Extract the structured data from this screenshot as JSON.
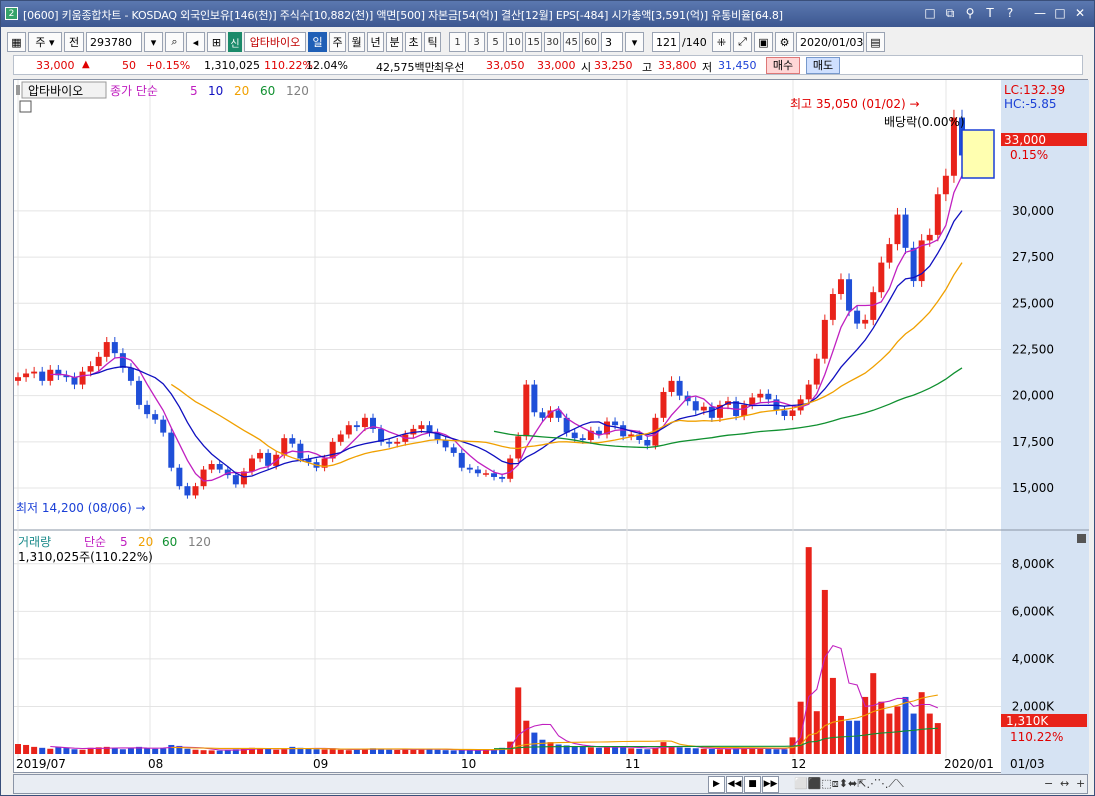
{
  "window": {
    "icon": "2",
    "title": "[0600] 키움종합차트 - KOSDAQ 외국인보유[146(천)] 주식수[10,882(천)] 액면[500] 자본금[54(억)] 결산[12월] EPS[-484] 시가총액[3,591(억)] 유통비율[64.8]",
    "controls": [
      "□",
      "⧉",
      "⚲",
      "T",
      "?",
      "—",
      "□",
      "✕"
    ]
  },
  "toolbar": {
    "period": "주",
    "prev": "전",
    "code": "293780",
    "sin": "신",
    "stock_name": "압타바이오",
    "timeframes": [
      "일",
      "주",
      "월",
      "년",
      "분",
      "초",
      "틱"
    ],
    "active_timeframe": "일",
    "intervals": [
      "1",
      "3",
      "5",
      "10",
      "15",
      "30",
      "45",
      "60"
    ],
    "interval_value": "3",
    "count": "121",
    "count_total": "/140",
    "date": "2020/01/03"
  },
  "quote": {
    "price": "33,000",
    "change": "50",
    "change_pct": "+0.15%",
    "volume": "1,310,025",
    "volume_ratio": "110.22%",
    "turnover": "12.04%",
    "amount": "42,575백만",
    "best_label": "최우선",
    "best_ask": "33,050",
    "best_bid": "33,000",
    "open_label": "시",
    "open": "33,250",
    "high_label": "고",
    "high": "33,800",
    "low_label": "저",
    "low": "31,450",
    "buy": "매수",
    "sell": "매도"
  },
  "chart": {
    "price_panel": {
      "name_tab": "압타바이오",
      "legend_prefix": "종가 단순",
      "ma_periods": [
        "5",
        "10",
        "20",
        "60",
        "120"
      ],
      "ma_colors": [
        "#c020c0",
        "#1010c0",
        "#f0a000",
        "#109030",
        "#808080"
      ],
      "lc": "LC:132.39",
      "hc": "HC:-5.85",
      "high_note": "최고 35,050 (01/02) →",
      "low_note": "최저 14,200 (08/06) →",
      "dividend": "배당락(0.00%)",
      "last_price": "33,000",
      "last_pct": "0.15%",
      "y_ticks": [
        "30,000",
        "27,500",
        "25,000",
        "22,500",
        "20,000",
        "17,500",
        "15,000"
      ]
    },
    "volume_panel": {
      "legend_title": "거래량",
      "legend_prefix": "단순",
      "ma_periods": [
        "5",
        "20",
        "60",
        "120"
      ],
      "value": "1,310,025주(110.22%)",
      "y_ticks": [
        "8,000K",
        "6,000K",
        "4,000K",
        "2,000K"
      ],
      "last_volume": "1,310K",
      "last_pct": "110.22%"
    },
    "x_labels": [
      "2019/07",
      "08",
      "09",
      "10",
      "11",
      "12",
      "2020/01"
    ],
    "right_date": "01/03",
    "up_color": "#e8231a",
    "down_color": "#1f4fd8"
  },
  "chart_data": {
    "type": "candlestick",
    "x": [
      "2019/07",
      "08",
      "09",
      "10",
      "11",
      "12",
      "2020/01"
    ],
    "close": [
      21000,
      21200,
      21300,
      20800,
      21400,
      21100,
      21000,
      20600,
      21300,
      21600,
      22100,
      22900,
      22300,
      21500,
      20800,
      19500,
      19000,
      18700,
      18000,
      16100,
      15100,
      14600,
      15100,
      16000,
      16300,
      16000,
      15700,
      15200,
      15900,
      16600,
      16900,
      16200,
      16800,
      17700,
      17400,
      16600,
      16400,
      16100,
      16600,
      17500,
      17900,
      18400,
      18300,
      18800,
      18200,
      17500,
      17400,
      17500,
      17900,
      18200,
      18400,
      18000,
      17600,
      17200,
      16900,
      16100,
      16000,
      15800,
      15800,
      15600,
      15500,
      16600,
      17800,
      20600,
      19100,
      18800,
      19200,
      18800,
      18000,
      17700,
      17600,
      18100,
      17900,
      18600,
      18400,
      17800,
      17900,
      17600,
      17300,
      18800,
      20200,
      20800,
      20000,
      19700,
      19200,
      19400,
      18800,
      19500,
      19700,
      18900,
      19500,
      19900,
      20100,
      19800,
      19200,
      18900,
      19200,
      19800,
      20600,
      22000,
      24100,
      25500,
      26300,
      24600,
      23900,
      24100,
      25600,
      27200,
      28200,
      29800,
      28000,
      26200,
      28400,
      28700,
      30900,
      31900,
      35050,
      33000
    ],
    "volume": [
      420,
      380,
      300,
      260,
      220,
      300,
      250,
      200,
      180,
      260,
      280,
      300,
      240,
      200,
      260,
      300,
      250,
      220,
      240,
      380,
      340,
      220,
      180,
      160,
      150,
      140,
      180,
      200,
      220,
      260,
      240,
      220,
      180,
      200,
      300,
      260,
      220,
      200,
      190,
      240,
      180,
      160,
      200,
      220,
      240,
      200,
      180,
      170,
      190,
      210,
      230,
      200,
      180,
      160,
      150,
      170,
      160,
      150,
      180,
      200,
      260,
      520,
      2800,
      1400,
      900,
      600,
      500,
      400,
      360,
      320,
      300,
      280,
      260,
      300,
      320,
      300,
      240,
      220,
      200,
      260,
      500,
      300,
      280,
      260,
      240,
      220,
      210,
      200,
      220,
      240,
      260,
      240,
      220,
      220,
      200,
      200,
      700,
      2200,
      8700,
      1800,
      6900,
      3200,
      1600,
      1400,
      1400,
      2400,
      3400,
      2200,
      1700,
      2000,
      2400,
      1700,
      2600,
      1700,
      1300
    ]
  }
}
